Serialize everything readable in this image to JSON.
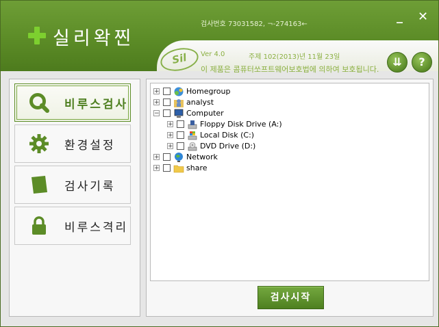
{
  "app": {
    "title": "실리왁찐",
    "serial": "검사번호 73031582, ¬-274163←",
    "badge": "Sil",
    "version": "Ver 4.0",
    "registration": "주제 102(2013)년 11월 23일",
    "copyright": "이 제품은 콤퓨터쏘프트웨어보호법에 의하여 보호됩니다.",
    "minimize_label": "_",
    "close_label": "✕",
    "update_label": "⇊",
    "help_label": "?"
  },
  "nav": {
    "items": [
      {
        "label": "비루스검사",
        "icon": "search-icon"
      },
      {
        "label": "환경설정",
        "icon": "gear-icon"
      },
      {
        "label": "검사기록",
        "icon": "document-icon"
      },
      {
        "label": "비루스격리",
        "icon": "lock-icon"
      }
    ]
  },
  "tree": {
    "items": [
      {
        "label": "Homegroup",
        "icon": "homegroup-icon",
        "expander": "+"
      },
      {
        "label": "analyst",
        "icon": "user-folder-icon",
        "expander": "+"
      },
      {
        "label": "Computer",
        "icon": "computer-icon",
        "expander": "−"
      },
      {
        "label": "Floppy Disk Drive (A:)",
        "icon": "floppy-drive-icon",
        "expander": "+"
      },
      {
        "label": "Local Disk (C:)",
        "icon": "local-disk-icon",
        "expander": "+"
      },
      {
        "label": "DVD Drive (D:)",
        "icon": "dvd-drive-icon",
        "expander": "+"
      },
      {
        "label": "Network",
        "icon": "network-icon",
        "expander": "+"
      },
      {
        "label": "share",
        "icon": "folder-icon",
        "expander": "+"
      }
    ]
  },
  "actions": {
    "start_scan_label": "검사시작"
  },
  "colors": {
    "brand_green": "#5c8c27",
    "accent_light_green": "#7dcf2f",
    "text_green": "#8bb042"
  }
}
